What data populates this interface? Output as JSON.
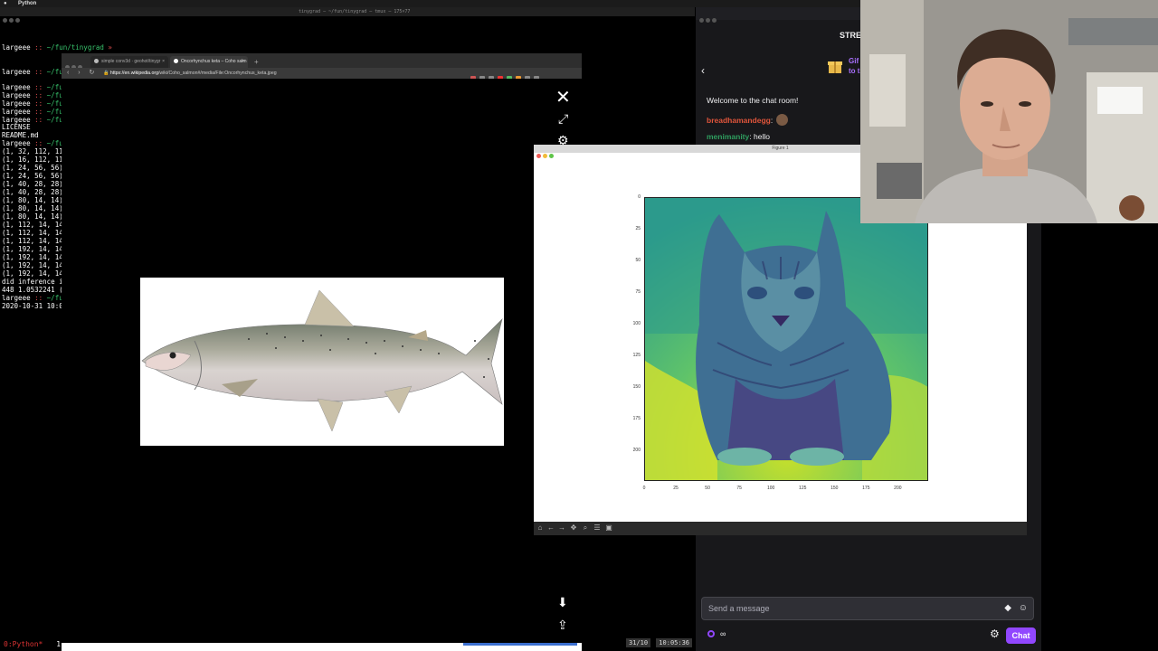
{
  "menubar": {
    "apple": "",
    "app_name": "Python"
  },
  "terminal": {
    "title": "tinygrad — ~/fun/tinygrad — tmux — 175×77",
    "lines": [
      {
        "top": 40,
        "user": "largeee",
        "path": "~/fun/tinygrad",
        "mark": " »"
      },
      {
        "top": 67,
        "user": "largeee",
        "path": "~/fu",
        "mark": ""
      },
      {
        "top": 84,
        "user": "largeee",
        "path": "~/fu",
        "mark": ""
      },
      {
        "top": 93,
        "user": "largeee",
        "path": "~/fu",
        "mark": ""
      },
      {
        "top": 102,
        "user": "largeee",
        "path": "~/fu",
        "mark": ""
      },
      {
        "top": 111,
        "user": "largeee",
        "path": "~/fu",
        "mark": ""
      },
      {
        "top": 120,
        "user": "largeee",
        "path": "~/fu",
        "mark": ""
      }
    ],
    "output": [
      "LICENSE",
      "README.md"
    ],
    "prompt2": {
      "user": "largeee",
      "path": "~/fu"
    },
    "shapes": [
      "(1, 32, 112, 11",
      "(1, 16, 112, 11",
      "(1, 24, 56, 56)",
      "(1, 24, 56, 56)",
      "(1, 40, 28, 28)",
      "(1, 40, 28, 28)",
      "(1, 80, 14, 14)",
      "(1, 80, 14, 14)",
      "(1, 80, 14, 14)",
      "(1, 112, 14, 14",
      "(1, 112, 14, 14",
      "(1, 112, 14, 14",
      "(1, 192, 14, 14",
      "(1, 192, 14, 14",
      "(1, 192, 14, 14",
      "(1, 192, 14, 14"
    ],
    "after": [
      "did inference i",
      "448 1.0532241 ("
    ],
    "prompt3": {
      "user": "largeee",
      "path": "~/fu"
    },
    "timestamp_line": "2020-10-31 10:0",
    "tmux_window": "0:Python*",
    "tmux_num": "1",
    "tmux_date": "31/10",
    "tmux_time": "10:05:36"
  },
  "browser": {
    "tabs": [
      {
        "label": "simple conv3d · geohot/tinygr",
        "active": false
      },
      {
        "label": "Oncorhynchus keta – Coho salm",
        "active": true
      }
    ],
    "new_tab": "+",
    "nav": "‹ › ↻",
    "url_host": "https://en.wikipedia.org",
    "url_path": "/wiki/Coho_salmon#/media/File:Oncorhynchus_keta.jpeg",
    "viewer": {
      "close": "✕",
      "expand": "⤢",
      "settings": "⚙",
      "download": "⬇",
      "share": "⇪"
    }
  },
  "chat": {
    "header": "STRE",
    "gift_text_1": "Gif",
    "gift_text_2": "to t",
    "welcome": "Welcome to the chat room!",
    "messages": [
      {
        "user": "breadhamandegg",
        "text": ""
      },
      {
        "user": "menimanity",
        "text": "hello"
      }
    ],
    "input_placeholder": "Send a message",
    "points": "∞",
    "send_label": "Chat",
    "colors": {
      "purple": "#9147ff",
      "bg": "#18181b"
    }
  },
  "figure": {
    "title": "Figure 1",
    "y_ticks": [
      "0",
      "25",
      "50",
      "75",
      "100",
      "125",
      "150",
      "175",
      "200"
    ],
    "x_ticks": [
      "0",
      "25",
      "50",
      "75",
      "100",
      "125",
      "150",
      "175",
      "200"
    ],
    "toolbar": [
      "home-icon",
      "back-icon",
      "forward-icon",
      "pan-icon",
      "zoom-icon",
      "subplots-icon",
      "save-icon"
    ]
  }
}
